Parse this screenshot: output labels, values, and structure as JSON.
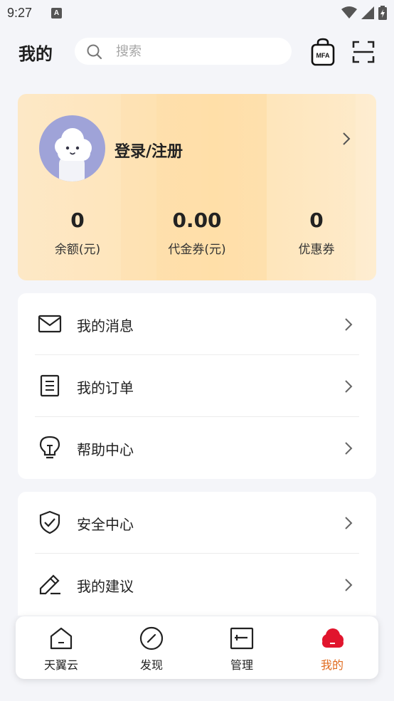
{
  "status_bar": {
    "time": "9:27",
    "notification_icon": "a-notification-icon",
    "icons": [
      "wifi-icon",
      "signal-icon",
      "battery-icon"
    ]
  },
  "header": {
    "title": "我的",
    "search": {
      "placeholder": "搜索"
    },
    "mfa_label": "MFA"
  },
  "profile": {
    "login_text": "登录/注册",
    "stats": [
      {
        "value": "0",
        "label": "余额(元)"
      },
      {
        "value": "0.00",
        "label": "代金券(元)"
      },
      {
        "value": "0",
        "label": "优惠券"
      }
    ]
  },
  "menu_groups": [
    [
      {
        "label": "我的消息",
        "icon": "mail-icon"
      },
      {
        "label": "我的订单",
        "icon": "order-document-icon"
      },
      {
        "label": "帮助中心",
        "icon": "lightbulb-icon"
      }
    ],
    [
      {
        "label": "安全中心",
        "icon": "shield-check-icon"
      },
      {
        "label": "我的建议",
        "icon": "edit-pen-icon"
      }
    ]
  ],
  "tabs": [
    {
      "label": "天翼云",
      "icon": "home-icon",
      "active": false
    },
    {
      "label": "发现",
      "icon": "compass-icon",
      "active": false
    },
    {
      "label": "管理",
      "icon": "manage-icon",
      "active": false
    },
    {
      "label": "我的",
      "icon": "cloud-profile-icon",
      "active": true
    }
  ],
  "colors": {
    "accent": "#e06b1f",
    "tab_active_icon": "#e1152d",
    "card_bg": "#fee6bd",
    "page_bg": "#f4f5f9"
  }
}
